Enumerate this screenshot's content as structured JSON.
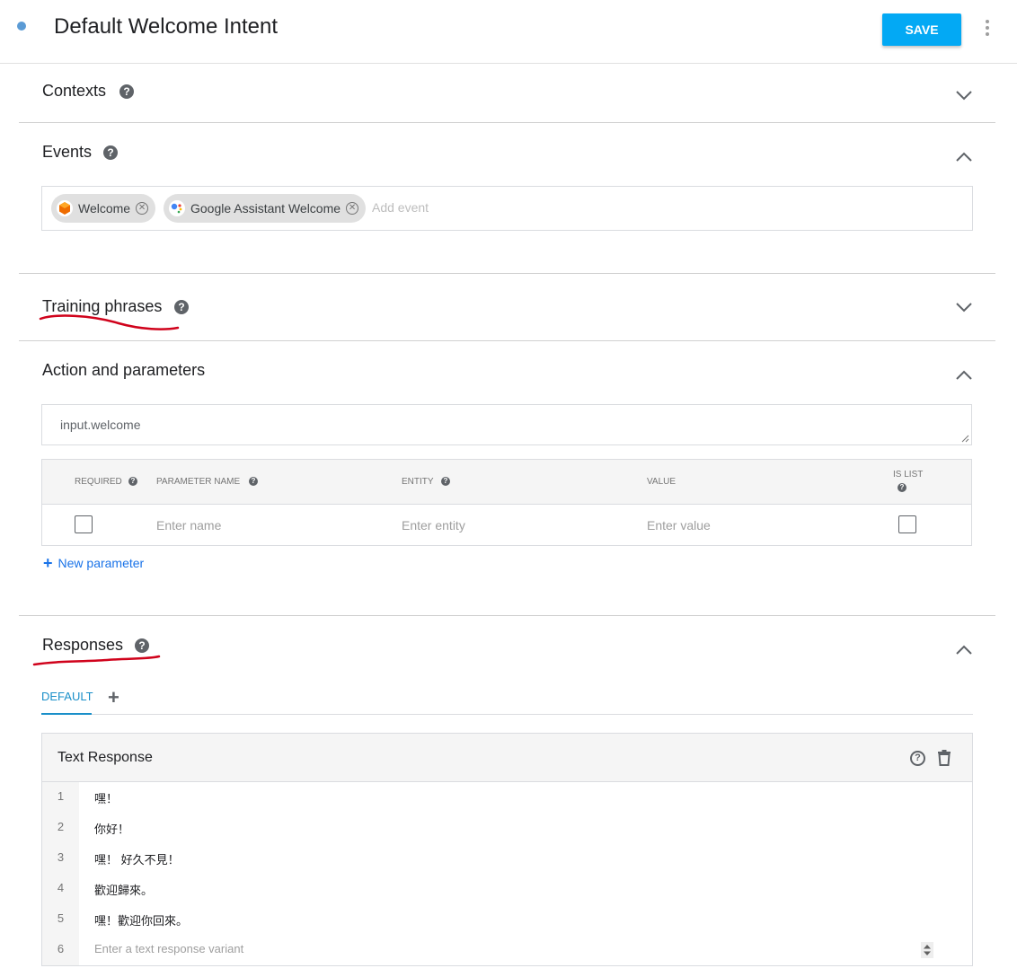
{
  "header": {
    "title": "Default Welcome Intent",
    "save_label": "SAVE"
  },
  "sections": {
    "contexts": {
      "title": "Contexts"
    },
    "events": {
      "title": "Events",
      "chips": [
        {
          "label": "Welcome",
          "icon": "dialogflow-icon"
        },
        {
          "label": "Google Assistant Welcome",
          "icon": "google-assistant-icon"
        }
      ],
      "add_placeholder": "Add event"
    },
    "training": {
      "title": "Training phrases"
    },
    "action": {
      "title": "Action and parameters",
      "action_value": "input.welcome",
      "columns": {
        "required": "REQUIRED",
        "parameter_name": "PARAMETER NAME",
        "entity": "ENTITY",
        "value": "VALUE",
        "is_list": "IS LIST"
      },
      "row": {
        "name_placeholder": "Enter name",
        "entity_placeholder": "Enter entity",
        "value_placeholder": "Enter value"
      },
      "new_parameter": "New parameter"
    },
    "responses": {
      "title": "Responses",
      "tab_default": "DEFAULT",
      "card_title": "Text Response",
      "lines": [
        {
          "num": "1",
          "text": "嘿！"
        },
        {
          "num": "2",
          "text": "你好！"
        },
        {
          "num": "3",
          "text": "嘿！ 好久不見！"
        },
        {
          "num": "4",
          "text": "歡迎歸來。"
        },
        {
          "num": "5",
          "text": "嘿！歡迎你回來。"
        }
      ],
      "new_line_num": "6",
      "new_line_placeholder": "Enter a text response variant"
    }
  },
  "colors": {
    "accent": "#03a9f4",
    "link": "#1a73e8",
    "tab_active": "#1a8fc9",
    "annotation": "#d0021b"
  }
}
